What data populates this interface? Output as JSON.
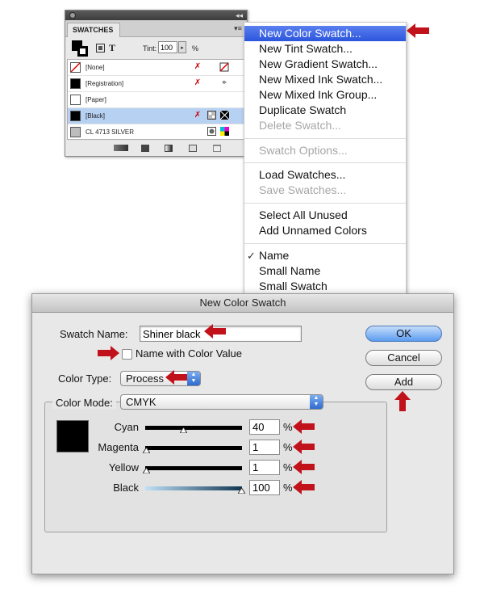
{
  "swatches_panel": {
    "tab_label": "SWATCHES",
    "collapse_glyph": "◂◂",
    "menu_glyph": "▾≡",
    "tint_label": "Tint:",
    "tint_value": "100",
    "tint_arrow": "▸",
    "tint_unit": "%",
    "format_text_glyph": "T",
    "rows": [
      {
        "name": "[None]"
      },
      {
        "name": "[Registration]"
      },
      {
        "name": "[Paper]"
      },
      {
        "name": "[Black]"
      },
      {
        "name": "CL 4713 SILVER"
      }
    ]
  },
  "flyout_menu": {
    "items": [
      {
        "label": "New Color Swatch...",
        "state": "highlighted"
      },
      {
        "label": "New Tint Swatch...",
        "state": "enabled"
      },
      {
        "label": "New Gradient Swatch...",
        "state": "enabled"
      },
      {
        "label": "New Mixed Ink Swatch...",
        "state": "enabled"
      },
      {
        "label": "New Mixed Ink Group...",
        "state": "enabled"
      },
      {
        "label": "Duplicate Swatch",
        "state": "enabled"
      },
      {
        "label": "Delete Swatch...",
        "state": "disabled"
      },
      {
        "label": "Swatch Options...",
        "state": "disabled"
      },
      {
        "label": "Load Swatches...",
        "state": "enabled"
      },
      {
        "label": "Save Swatches...",
        "state": "disabled"
      },
      {
        "label": "Select All Unused",
        "state": "enabled"
      },
      {
        "label": "Add Unnamed Colors",
        "state": "enabled"
      },
      {
        "label": "Name",
        "state": "checked"
      },
      {
        "label": "Small Name",
        "state": "enabled"
      },
      {
        "label": "Small Swatch",
        "state": "enabled"
      }
    ],
    "check_glyph": "✓"
  },
  "dialog": {
    "title": "New Color Swatch",
    "swatch_name_label": "Swatch Name:",
    "swatch_name_value": "Shiner black",
    "name_with_color_value_label": "Name with Color Value",
    "name_with_color_value_checked": false,
    "color_type_label": "Color Type:",
    "color_type_value": "Process",
    "color_mode_label": "Color Mode:",
    "color_mode_value": "CMYK",
    "stepper_glyph": "▲▼",
    "preview_color": "#000000",
    "sliders": [
      {
        "label": "Cyan",
        "value": "40",
        "unit": "%"
      },
      {
        "label": "Magenta",
        "value": "1",
        "unit": "%"
      },
      {
        "label": "Yellow",
        "value": "1",
        "unit": "%"
      },
      {
        "label": "Black",
        "value": "100",
        "unit": "%"
      }
    ],
    "ok_label": "OK",
    "cancel_label": "Cancel",
    "add_label": "Add"
  },
  "colors": {
    "highlight": "#2b55dd",
    "annotation_arrow": "#c1121c",
    "default_button": "#5b9cef"
  }
}
